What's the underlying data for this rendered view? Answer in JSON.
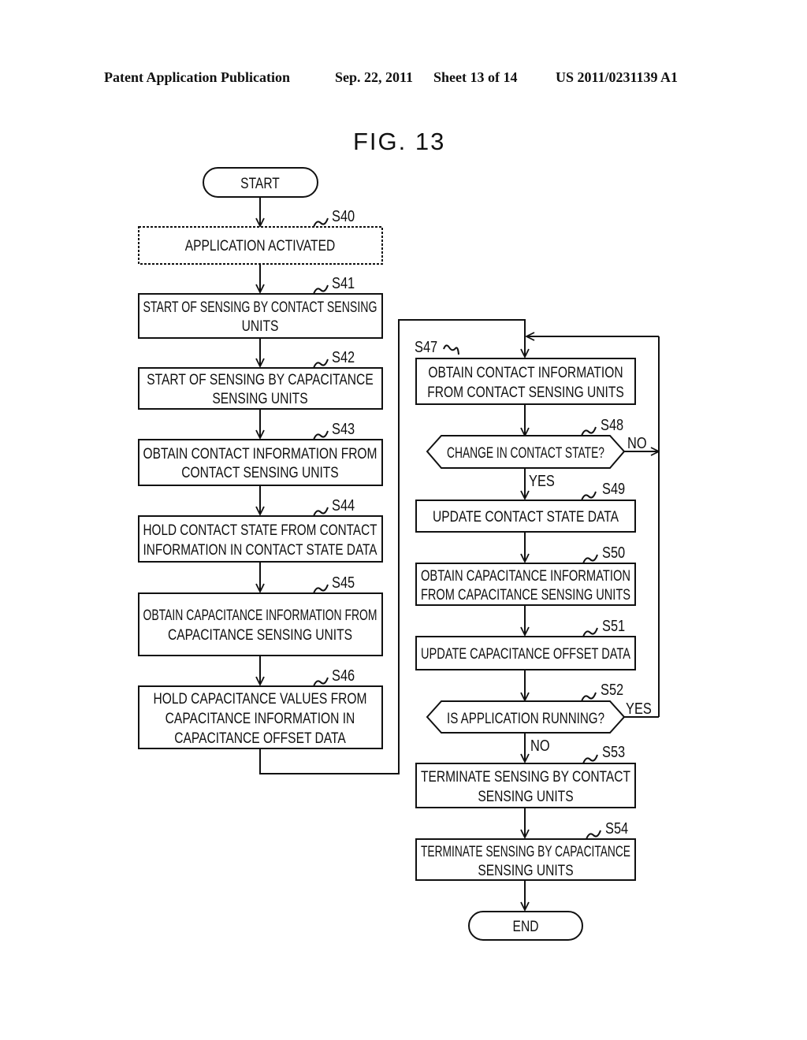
{
  "header": {
    "publication": "Patent Application Publication",
    "date": "Sep. 22, 2011",
    "sheet": "Sheet 13 of 14",
    "number": "US 2011/0231139 A1"
  },
  "figure": {
    "title": "FIG. 13"
  },
  "flowchart": {
    "start": "START",
    "end": "END",
    "steps": {
      "s40": {
        "id": "S40",
        "lines": [
          "APPLICATION ACTIVATED"
        ],
        "style": "dashed"
      },
      "s41": {
        "id": "S41",
        "lines": [
          "START OF SENSING BY CONTACT SENSING",
          "UNITS"
        ]
      },
      "s42": {
        "id": "S42",
        "lines": [
          "START OF SENSING BY CAPACITANCE",
          "SENSING UNITS"
        ]
      },
      "s43": {
        "id": "S43",
        "lines": [
          "OBTAIN CONTACT INFORMATION FROM",
          "CONTACT SENSING UNITS"
        ]
      },
      "s44": {
        "id": "S44",
        "lines": [
          "HOLD CONTACT STATE FROM CONTACT",
          "INFORMATION IN CONTACT STATE DATA"
        ]
      },
      "s45": {
        "id": "S45",
        "lines": [
          "OBTAIN CAPACITANCE INFORMATION FROM",
          "CAPACITANCE SENSING UNITS"
        ]
      },
      "s46": {
        "id": "S46",
        "lines": [
          "HOLD CAPACITANCE VALUES FROM",
          "CAPACITANCE INFORMATION IN",
          "CAPACITANCE OFFSET DATA"
        ]
      },
      "s47": {
        "id": "S47",
        "lines": [
          "OBTAIN CONTACT INFORMATION",
          "FROM CONTACT SENSING UNITS"
        ]
      },
      "s48": {
        "id": "S48",
        "lines": [
          "CHANGE IN CONTACT STATE?"
        ],
        "type": "decision",
        "yes": "YES",
        "no": "NO"
      },
      "s49": {
        "id": "S49",
        "lines": [
          "UPDATE CONTACT STATE DATA"
        ]
      },
      "s50": {
        "id": "S50",
        "lines": [
          "OBTAIN CAPACITANCE INFORMATION",
          "FROM CAPACITANCE SENSING UNITS"
        ]
      },
      "s51": {
        "id": "S51",
        "lines": [
          "UPDATE CAPACITANCE OFFSET DATA"
        ]
      },
      "s52": {
        "id": "S52",
        "lines": [
          "IS APPLICATION RUNNING?"
        ],
        "type": "decision",
        "yes": "YES",
        "no": "NO"
      },
      "s53": {
        "id": "S53",
        "lines": [
          "TERMINATE SENSING BY CONTACT",
          "SENSING UNITS"
        ]
      },
      "s54": {
        "id": "S54",
        "lines": [
          "TERMINATE SENSING BY CAPACITANCE",
          "SENSING UNITS"
        ]
      }
    }
  }
}
